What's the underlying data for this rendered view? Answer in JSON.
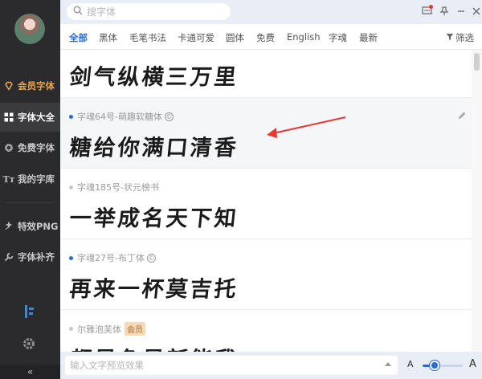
{
  "search": {
    "placeholder": "搜字体"
  },
  "sidebar": {
    "items": [
      {
        "label": "会员字体",
        "icon": "diamond-icon"
      },
      {
        "label": "字体大全",
        "icon": "grid-icon"
      },
      {
        "label": "免费字体",
        "icon": "free-icon"
      },
      {
        "label": "我的字库",
        "icon": "font-tt-icon"
      },
      {
        "label": "特效PNG",
        "icon": "sparkle-icon"
      },
      {
        "label": "字体补齐",
        "icon": "wrench-icon"
      }
    ],
    "collapse_label": "«"
  },
  "tabs": [
    "全部",
    "黑体",
    "毛笔书法",
    "卡通可爱",
    "圆体",
    "免费",
    "English",
    "字魂",
    "最新"
  ],
  "filter_label": "筛选",
  "fonts": [
    {
      "name": "",
      "preview": "剑气纵横三万里"
    },
    {
      "name": "字魂64号-萌趣软糖体",
      "preview": "糖给你满口清香",
      "copyright": "©"
    },
    {
      "name": "字魂185号-状元榜书",
      "preview": "一举成名天下知"
    },
    {
      "name": "字魂27号-布丁体",
      "preview": "再来一杯莫吉托",
      "copyright": "©"
    },
    {
      "name": "尔雅泡芙体",
      "badge": "会员",
      "preview": "都是色是新能我"
    }
  ],
  "bottom": {
    "input_placeholder": "输入文字预览效果",
    "size_small": "A",
    "size_large": "A",
    "font_size_level": 0.3
  },
  "colors": {
    "accent": "#2a6bd6",
    "vip": "#f0a44b",
    "sidebar_bg": "#2b2b2d",
    "arrow": "#e53935"
  }
}
